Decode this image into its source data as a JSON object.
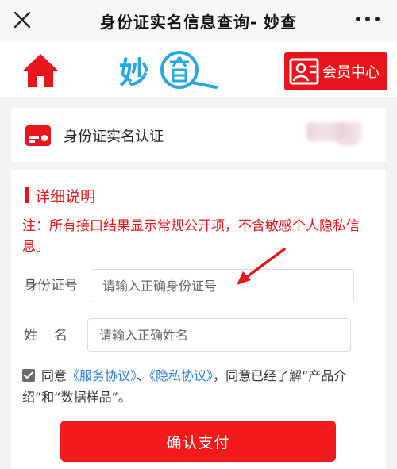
{
  "titlebar": {
    "title": "身份证实名信息查询- 妙查"
  },
  "header": {
    "logo_text": "妙",
    "member_label": "会员中心"
  },
  "service": {
    "label": "身份证实名认证"
  },
  "details": {
    "section_title": "详细说明",
    "notice": "注：所有接口结果显示常规公开项，不含敏感个人隐私信息。"
  },
  "form": {
    "id_label": "身份证号",
    "id_placeholder": "请输入正确身份证号",
    "name_label": "姓　名",
    "name_placeholder": "请输入正确姓名"
  },
  "agreement": {
    "checked": true,
    "prefix": "同意",
    "service_link": "《服务协议》",
    "separator": "、",
    "privacy_link": "《隐私协议》",
    "suffix": "，同意已经了解“产品介绍”和“数据样品”。"
  },
  "pay_button": {
    "label": "确认支付"
  },
  "colors": {
    "accent": "#e8151b",
    "logo_blue": "#2aa7e0",
    "link": "#2a7ae0"
  }
}
